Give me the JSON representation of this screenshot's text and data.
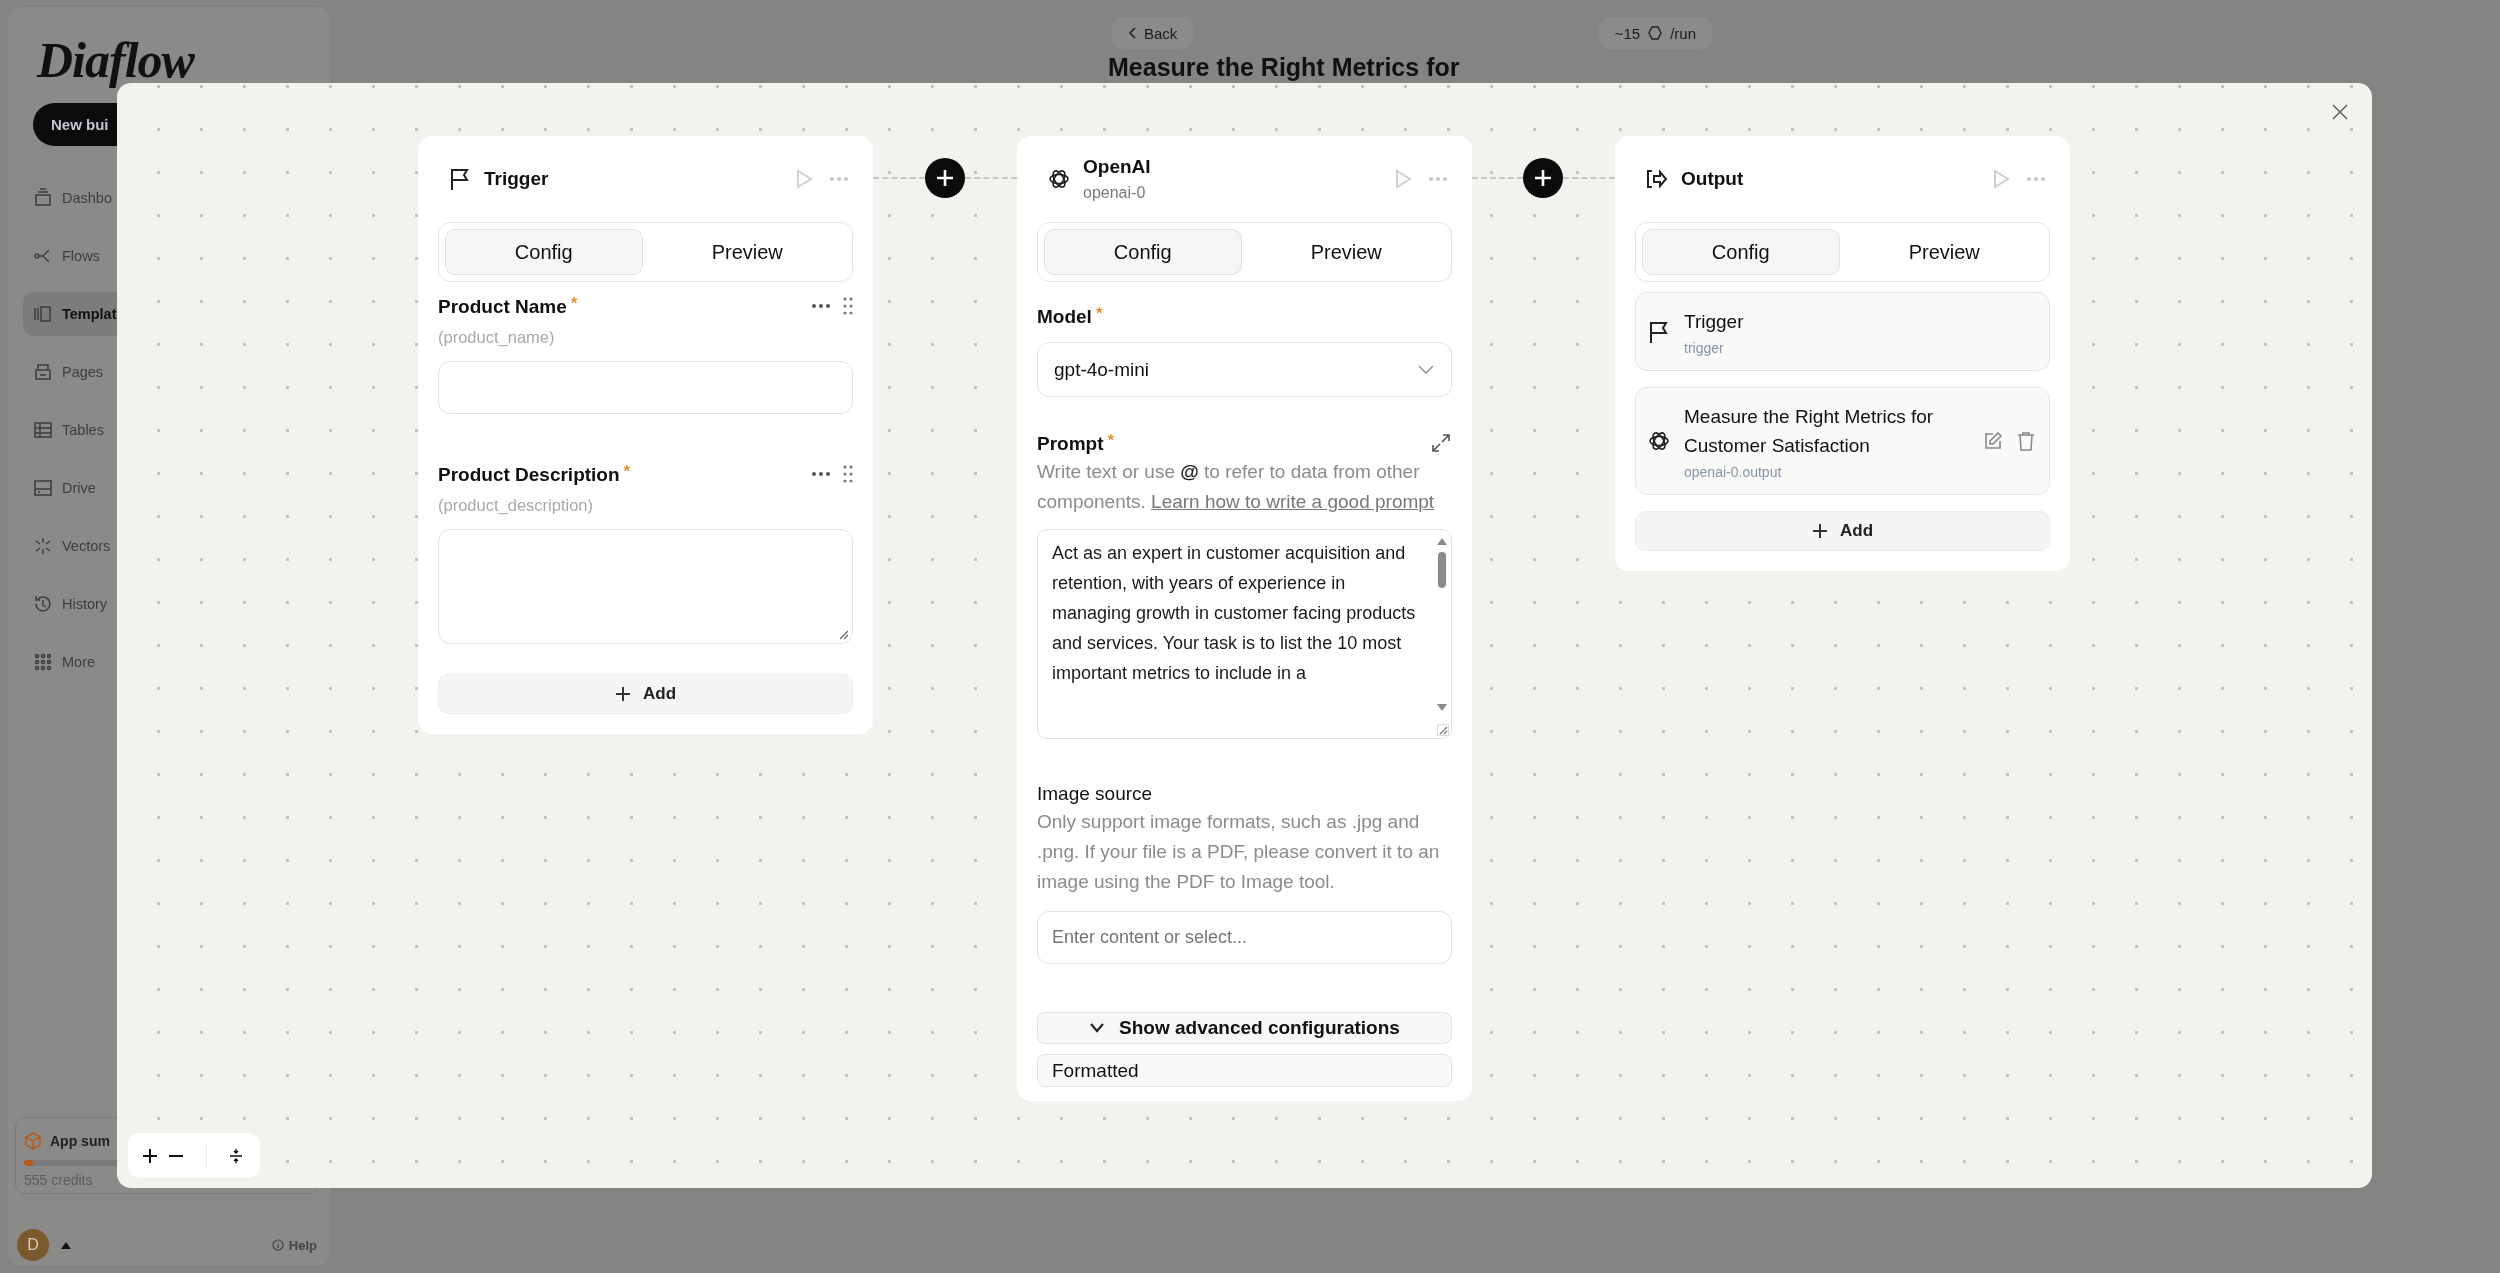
{
  "sidebar": {
    "logo": "Diaflow",
    "new_button": "New bui",
    "items": [
      {
        "label": "Dashbo",
        "selected": false
      },
      {
        "label": "Flows",
        "selected": false
      },
      {
        "label": "Templat",
        "selected": true
      },
      {
        "label": "Pages",
        "selected": false
      },
      {
        "label": "Tables",
        "selected": false
      },
      {
        "label": "Drive",
        "selected": false
      },
      {
        "label": "Vectors",
        "selected": false
      },
      {
        "label": "History",
        "selected": false
      },
      {
        "label": "More",
        "selected": false
      }
    ],
    "usage": {
      "title": "App sum",
      "level": 0.03,
      "credits": "555 credits"
    },
    "user": {
      "avatar": "D"
    },
    "help": "Help"
  },
  "header": {
    "back": "Back",
    "cost": {
      "amount": "~15",
      "unit": "/run"
    },
    "title": "Measure the Right Metrics for"
  },
  "modal": {
    "nodes": [
      {
        "kind": "trigger",
        "title": "Trigger",
        "tabs": [
          {
            "label": "Config",
            "selected": true
          },
          {
            "label": "Preview",
            "selected": false
          }
        ],
        "fields": [
          {
            "kind": "text",
            "label": "Product Name",
            "required_mark": "*",
            "variable": "(product_name)"
          },
          {
            "kind": "textarea",
            "label": "Product Description",
            "required_mark": "*",
            "variable": "(product_description)"
          }
        ],
        "add": "Add"
      },
      {
        "kind": "openai",
        "title": "OpenAI",
        "subtitle": "openai-0",
        "tabs": [
          {
            "label": "Config",
            "selected": true
          },
          {
            "label": "Preview",
            "selected": false
          }
        ],
        "model": {
          "label": "Model",
          "required_mark": "*",
          "value": "gpt-4o-mini"
        },
        "prompt": {
          "label": "Prompt",
          "required_mark": "*",
          "hint": "Write text or use **@** to refer to data from other components.",
          "link": "Learn how to write a good prompt",
          "value": "Act as an expert in customer acquisition and retention, with years of experience in managing growth in customer facing products and services. Your task is to list the 10 most important metrics to include in a"
        },
        "image_source": {
          "label": "Image source",
          "hint": "Only support image formats, such as .jpg and .png. If your file is a PDF, please convert it to an image using the PDF to Image tool.",
          "placeholder": "Enter content or select..."
        },
        "advanced": "Show advanced configurations",
        "format": "Formatted"
      },
      {
        "kind": "output",
        "title": "Output",
        "tabs": [
          {
            "label": "Config",
            "selected": true
          },
          {
            "label": "Preview",
            "selected": false
          }
        ],
        "items": [
          {
            "kind": "trigger",
            "title": "Trigger",
            "subtitle": "trigger"
          },
          {
            "kind": "openai",
            "title": "Measure the Right Metrics for Customer Satisfaction",
            "subtitle": "openai-0.output"
          }
        ],
        "add": "Add"
      }
    ]
  }
}
